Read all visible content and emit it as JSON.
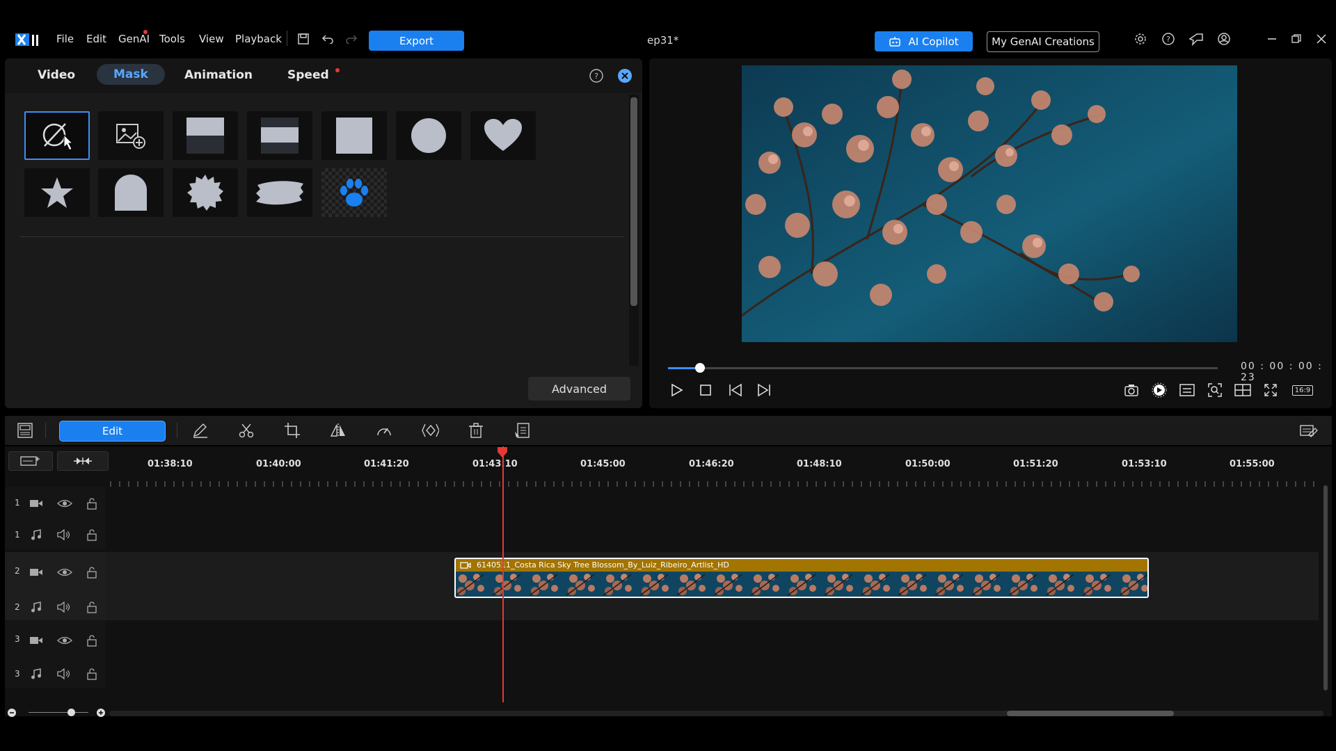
{
  "menu": {
    "items": [
      "File",
      "Edit",
      "GenAI",
      "Tools",
      "View",
      "Playback"
    ],
    "export_label": "Export",
    "project_title": "ep31*",
    "ai_copilot_label": "AI Copilot",
    "my_genai_label": "My GenAI Creations"
  },
  "panel": {
    "tabs": [
      "Video",
      "Mask",
      "Animation",
      "Speed"
    ],
    "active_tab": "Mask",
    "mask_tiles": [
      "no-mask",
      "image-mask",
      "top-half",
      "middle-band",
      "square",
      "circle",
      "heart",
      "star",
      "arch",
      "starburst",
      "brush-stroke",
      "paw-print"
    ],
    "advanced_label": "Advanced"
  },
  "preview": {
    "timecode": "00 : 00 : 00 : 23",
    "progress": 0.058,
    "aspect_label": "16:9"
  },
  "toolbar": {
    "edit_label": "Edit"
  },
  "timeline": {
    "ruler": [
      "01:38:10",
      "01:40:00",
      "01:41:20",
      "01:43:10",
      "01:45:00",
      "01:46:20",
      "01:48:10",
      "01:50:00",
      "01:51:20",
      "01:53:10",
      "01:55:00"
    ],
    "tracks": [
      {
        "num": "1",
        "kind": "video"
      },
      {
        "num": "1",
        "kind": "audio"
      },
      {
        "num": "2",
        "kind": "video"
      },
      {
        "num": "2",
        "kind": "audio"
      },
      {
        "num": "3",
        "kind": "video"
      },
      {
        "num": "3",
        "kind": "audio"
      }
    ],
    "clip_title": "6140511_Costa Rica Sky Tree Blossom_By_Luiz_Ribeiro_Artlist_HD"
  },
  "colors": {
    "accent": "#1a80f0",
    "playhead": "#e53935",
    "clip_bar": "#a27400"
  }
}
